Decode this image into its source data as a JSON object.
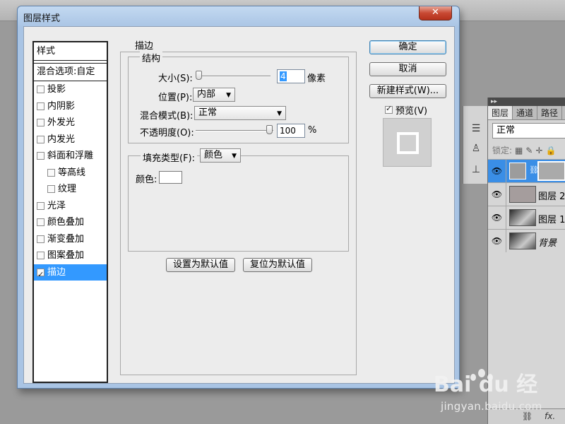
{
  "dialog": {
    "title": "图层样式",
    "close_label": "✕"
  },
  "styles_list": {
    "header": "样式",
    "blend_options": "混合选项:自定",
    "items": [
      {
        "label": "投影",
        "checked": false
      },
      {
        "label": "内阴影",
        "checked": false
      },
      {
        "label": "外发光",
        "checked": false
      },
      {
        "label": "内发光",
        "checked": false
      },
      {
        "label": "斜面和浮雕",
        "checked": false
      },
      {
        "label": "等高线",
        "checked": false,
        "sub": true
      },
      {
        "label": "纹理",
        "checked": false,
        "sub": true
      },
      {
        "label": "光泽",
        "checked": false
      },
      {
        "label": "颜色叠加",
        "checked": false
      },
      {
        "label": "渐变叠加",
        "checked": false
      },
      {
        "label": "图案叠加",
        "checked": false
      },
      {
        "label": "描边",
        "checked": true,
        "selected": true
      }
    ]
  },
  "stroke": {
    "section_title": "描边",
    "structure_title": "结构",
    "size_label": "大小(S):",
    "size_value": "4",
    "size_unit": "像素",
    "position_label": "位置(P):",
    "position_value": "内部",
    "blend_mode_label": "混合模式(B):",
    "blend_mode_value": "正常",
    "opacity_label": "不透明度(O):",
    "opacity_value": "100",
    "opacity_unit": "%",
    "fill_type_label": "填充类型(F):",
    "fill_type_value": "颜色",
    "color_label": "颜色:",
    "stroke_color": "#ffffff",
    "set_default_label": "设置为默认值",
    "reset_default_label": "复位为默认值"
  },
  "buttons": {
    "ok": "确定",
    "cancel": "取消",
    "new_style": "新建样式(W)...",
    "preview_label": "预览(V)"
  },
  "layers_panel": {
    "header": "▸▸",
    "tabs": [
      "图层",
      "通道",
      "路径"
    ],
    "blend_mode": "正常",
    "lock_label": "锁定:",
    "layers": [
      {
        "name": "",
        "selected": true
      },
      {
        "name": "图层 2",
        "selected": false
      },
      {
        "name": "图层 1",
        "selected": false
      },
      {
        "name": "背景",
        "selected": false
      }
    ],
    "bottom_icons": [
      "link-icon",
      "fx-icon"
    ],
    "fx_label": "fx."
  },
  "watermark": {
    "logo_text": "Bai du 经验",
    "url": "jingyan.baidu.com"
  }
}
